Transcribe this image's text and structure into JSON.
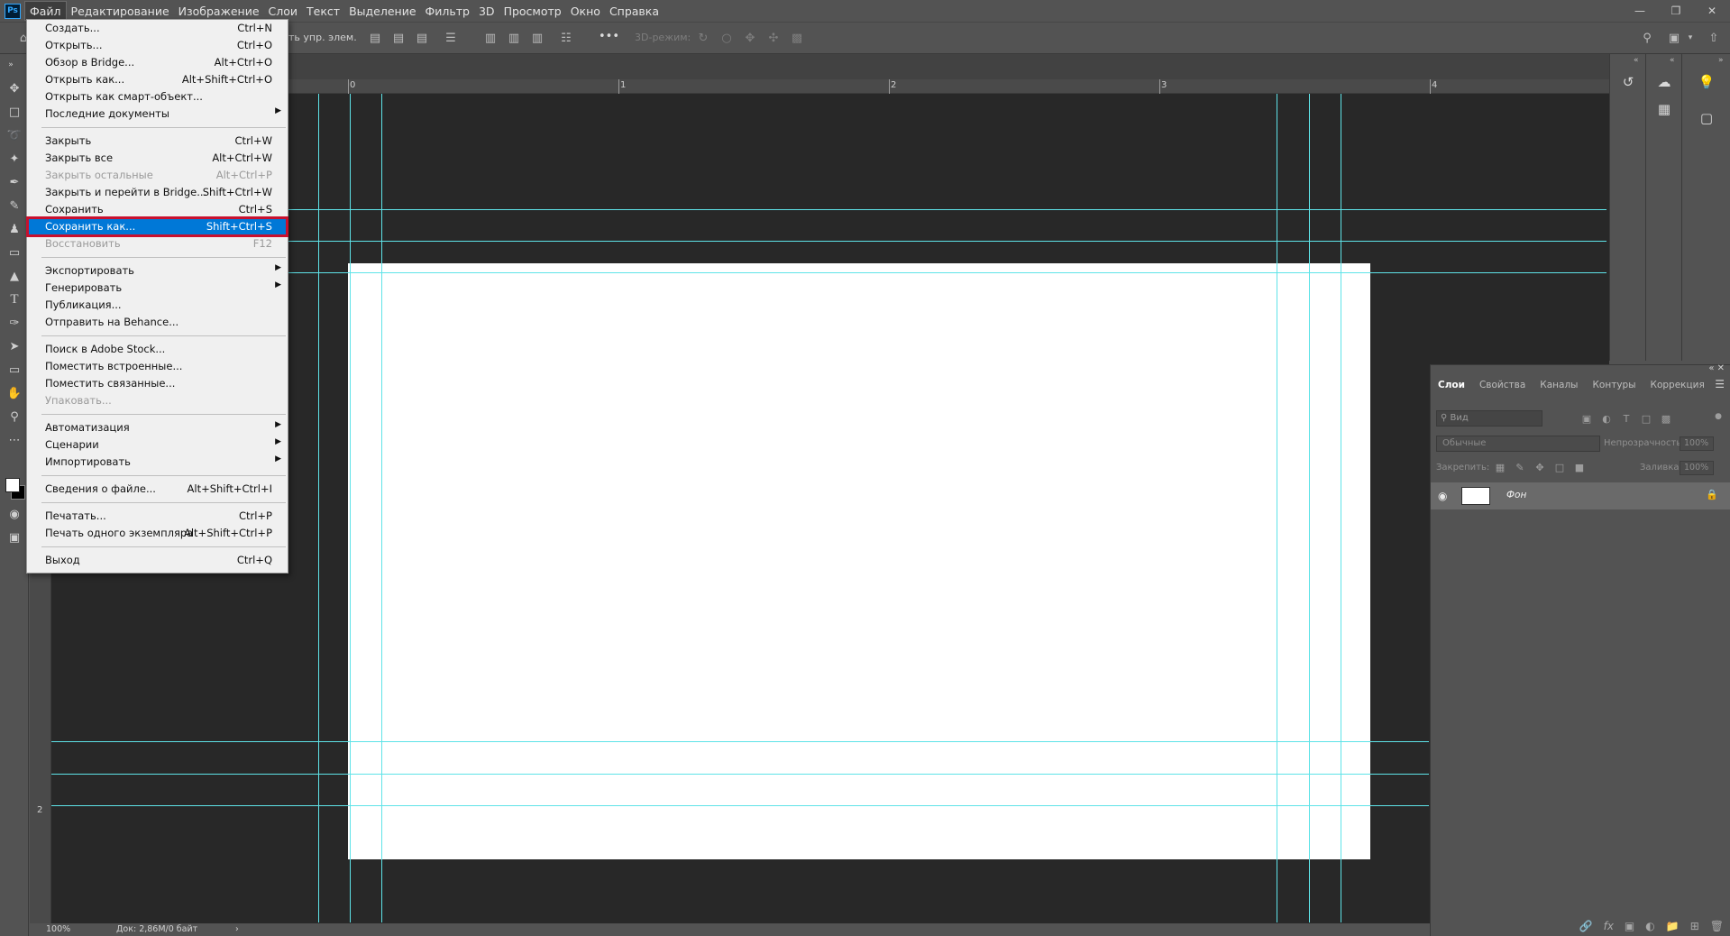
{
  "app": {
    "logo": "Ps"
  },
  "menubar": {
    "items": [
      "Файл",
      "Редактирование",
      "Изображение",
      "Слои",
      "Текст",
      "Выделение",
      "Фильтр",
      "3D",
      "Просмотр",
      "Окно",
      "Справка"
    ],
    "active_index": 0,
    "window_controls": [
      "minimize-icon",
      "restore-icon",
      "close-icon"
    ]
  },
  "options_bar": {
    "auto_select_label": "ть упр. элем.",
    "mode_3d_label": "3D-режим:",
    "more": "•••"
  },
  "file_menu": {
    "items": [
      {
        "label": "Создать...",
        "shortcut": "Ctrl+N"
      },
      {
        "label": "Открыть...",
        "shortcut": "Ctrl+O"
      },
      {
        "label": "Обзор в Bridge...",
        "shortcut": "Alt+Ctrl+O"
      },
      {
        "label": "Открыть как...",
        "shortcut": "Alt+Shift+Ctrl+O"
      },
      {
        "label": "Открыть как смарт-объект...",
        "shortcut": ""
      },
      {
        "label": "Последние документы",
        "shortcut": "",
        "submenu": true
      },
      {
        "separator": true
      },
      {
        "label": "Закрыть",
        "shortcut": "Ctrl+W"
      },
      {
        "label": "Закрыть все",
        "shortcut": "Alt+Ctrl+W"
      },
      {
        "label": "Закрыть остальные",
        "shortcut": "Alt+Ctrl+P",
        "disabled": true
      },
      {
        "label": "Закрыть и перейти в Bridge...",
        "shortcut": "Shift+Ctrl+W"
      },
      {
        "label": "Сохранить",
        "shortcut": "Ctrl+S"
      },
      {
        "label": "Сохранить как...",
        "shortcut": "Shift+Ctrl+S",
        "highlighted": true
      },
      {
        "label": "Восстановить",
        "shortcut": "F12",
        "disabled": true
      },
      {
        "separator": true
      },
      {
        "label": "Экспортировать",
        "shortcut": "",
        "submenu": true
      },
      {
        "label": "Генерировать",
        "shortcut": "",
        "submenu": true
      },
      {
        "label": "Публикация...",
        "shortcut": ""
      },
      {
        "label": "Отправить на Behance...",
        "shortcut": ""
      },
      {
        "separator": true
      },
      {
        "label": "Поиск в Adobe Stock...",
        "shortcut": ""
      },
      {
        "label": "Поместить встроенные...",
        "shortcut": ""
      },
      {
        "label": "Поместить связанные...",
        "shortcut": ""
      },
      {
        "label": "Упаковать...",
        "shortcut": "",
        "disabled": true
      },
      {
        "separator": true
      },
      {
        "label": "Автоматизация",
        "shortcut": "",
        "submenu": true
      },
      {
        "label": "Сценарии",
        "shortcut": "",
        "submenu": true
      },
      {
        "label": "Импортировать",
        "shortcut": "",
        "submenu": true
      },
      {
        "separator": true
      },
      {
        "label": "Сведения о файле...",
        "shortcut": "Alt+Shift+Ctrl+I"
      },
      {
        "separator": true
      },
      {
        "label": "Печатать...",
        "shortcut": "Ctrl+P"
      },
      {
        "label": "Печать одного экземпляра",
        "shortcut": "Alt+Shift+Ctrl+P"
      },
      {
        "separator": true
      },
      {
        "label": "Выход",
        "shortcut": "Ctrl+Q"
      }
    ]
  },
  "rulers": {
    "top_numbers": [
      "0",
      "1",
      "2",
      "3",
      "4"
    ],
    "left_numbers": [
      "2"
    ]
  },
  "status_bar": {
    "zoom": "100%",
    "doc_info": "Док: 2,86M/0 байт",
    "arrow": "›"
  },
  "layers_panel": {
    "tabs": [
      "Слои",
      "Свойства",
      "Каналы",
      "Контуры",
      "Коррекция"
    ],
    "active_tab": 0,
    "filter_placeholder": "Вид",
    "blend_mode": "Обычные",
    "opacity_label": "Непрозрачность:",
    "opacity_value": "100%",
    "lock_label": "Закрепить:",
    "fill_label": "Заливка:",
    "fill_value": "100%",
    "layers": [
      {
        "name": "Фон",
        "visible": true,
        "locked": true
      }
    ]
  },
  "colors": {
    "guide": "#5ee3e8",
    "highlight": "#0078d7",
    "highlight_border": "#c8102e",
    "panel_bg": "#535353",
    "doc_bg": "#282828"
  }
}
